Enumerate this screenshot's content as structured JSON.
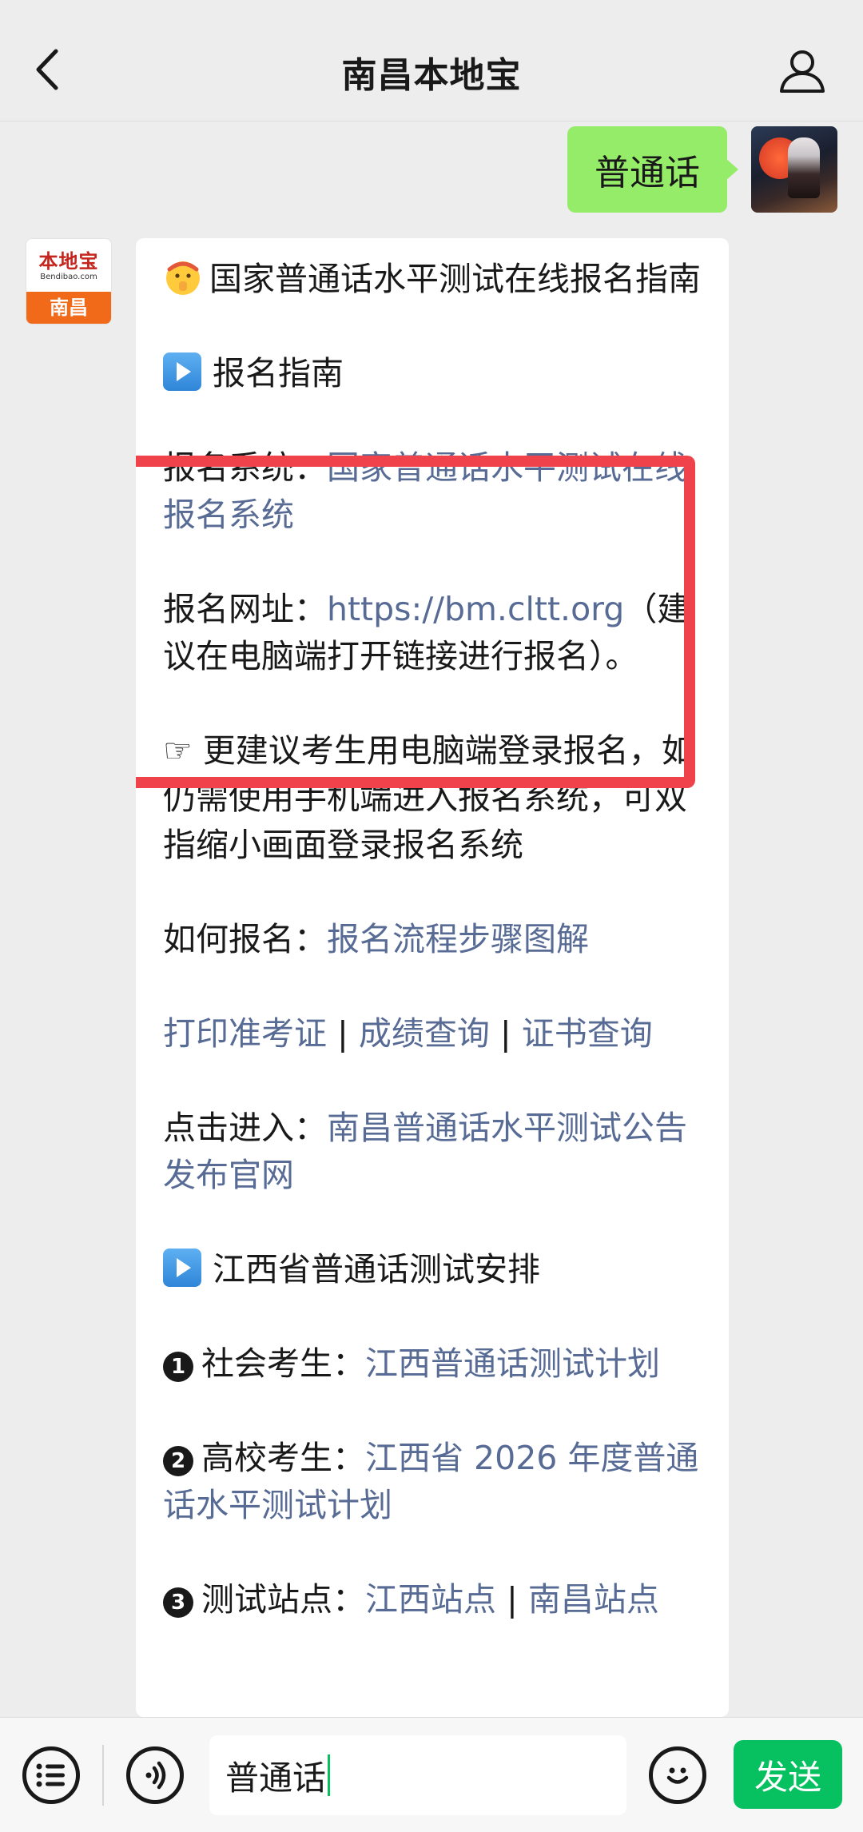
{
  "header": {
    "title": "南昌本地宝"
  },
  "outgoing": {
    "text": "普通话"
  },
  "bot_avatar": {
    "top": "本地宝",
    "sub": "Bendibao.com",
    "bottom": "南昌"
  },
  "message": {
    "title_line": "国家普通话水平测试在线报名指南",
    "section1": "报名指南",
    "sys_label": "报名系统：",
    "sys_link": "国家普通话水平测试在线报名系统",
    "url_label": "报名网址：",
    "url_link": "https://bm.cltt.org",
    "url_note": "（建议在电脑端打开链接进行报名）。",
    "tip": "☞ 更建议考生用电脑端登录报名，如仍需使用手机端进入报名系统，可双指缩小画面登录报名系统",
    "how_label": "如何报名：",
    "how_link": "报名流程步骤图解",
    "links_row": [
      "打印准考证",
      "成绩查询",
      "证书查询"
    ],
    "sep": " | ",
    "enter_label": "点击进入：",
    "enter_link": "南昌普通话水平测试公告发布官网",
    "section2": "江西省普通话测试安排",
    "item1_num": "1",
    "item1_label": "社会考生：",
    "item1_link": "江西普通话测试计划",
    "item2_num": "2",
    "item2_label": "高校考生：",
    "item2_link": "江西省 2026 年度普通话水平测试计划",
    "item3_num": "3",
    "item3_label": "测试站点：",
    "item3_link_a": "江西站点",
    "item3_link_b": "南昌站点"
  },
  "input": {
    "text": "普通话"
  },
  "send": {
    "label": "发送"
  },
  "colors": {
    "link": "#576b95",
    "outgoing_bubble": "#95ec69",
    "send_button": "#07c160",
    "highlight": "#f0424a"
  }
}
